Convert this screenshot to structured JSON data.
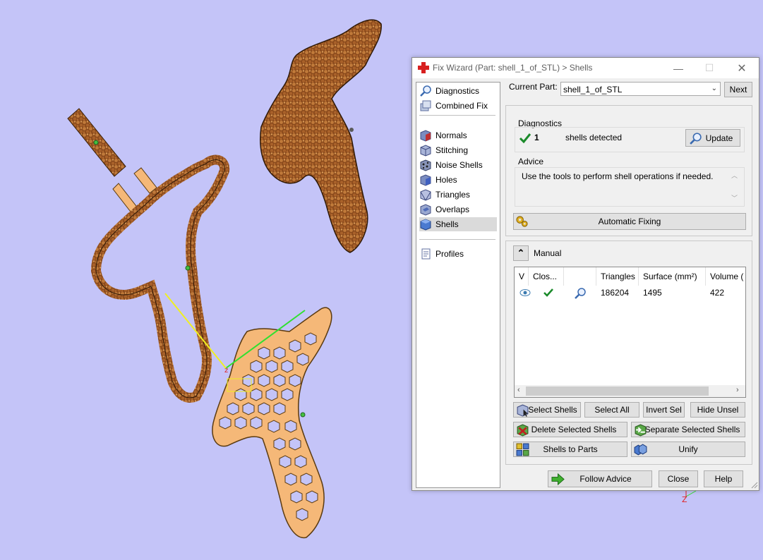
{
  "window": {
    "title": "Fix Wizard (Part: shell_1_of_STL) > Shells",
    "min_glyph": "—",
    "max_glyph": "☐",
    "close_glyph": "✕"
  },
  "nav": {
    "items": [
      {
        "label": "Diagnostics",
        "icon": "magnifier-icon"
      },
      {
        "label": "Combined Fix",
        "icon": "box-stack-icon"
      },
      {
        "label": "Normals",
        "icon": "normals-cube-icon"
      },
      {
        "label": "Stitching",
        "icon": "stitching-cube-icon"
      },
      {
        "label": "Noise Shells",
        "icon": "noise-shells-icon"
      },
      {
        "label": "Holes",
        "icon": "holes-cube-icon"
      },
      {
        "label": "Triangles",
        "icon": "triangles-cube-icon"
      },
      {
        "label": "Overlaps",
        "icon": "overlaps-cube-icon"
      },
      {
        "label": "Shells",
        "icon": "shells-cube-icon"
      },
      {
        "label": "Profiles",
        "icon": "document-icon"
      }
    ],
    "selected": "Shells"
  },
  "part": {
    "label": "Current Part:",
    "value": "shell_1_of_STL",
    "next_label": "Next"
  },
  "diagnostics": {
    "heading": "Diagnostics",
    "count": "1",
    "text": "shells detected",
    "update_label": "Update"
  },
  "advice": {
    "heading": "Advice",
    "text": "Use the tools to perform shell operations if needed."
  },
  "automatic_fixing_label": "Automatic Fixing",
  "manual": {
    "label": "Manual",
    "columns": [
      "V",
      "Clos...",
      "",
      "Triangles",
      "Surface (mm²)",
      "Volume ("
    ],
    "rows": [
      {
        "triangles": "186204",
        "surface": "1495",
        "volume": "422"
      }
    ]
  },
  "actions": {
    "select_shells": "Select Shells",
    "select_all": "Select All",
    "invert_sel": "Invert Sel",
    "hide_unsel": "Hide Unsel",
    "delete_selected": "Delete Selected Shells",
    "separate_selected": "Separate Selected Shells",
    "shells_to_parts": "Shells to Parts",
    "unify": "Unify"
  },
  "footer": {
    "follow_advice": "Follow Advice",
    "close": "Close",
    "help": "Help"
  },
  "viewport": {
    "axis_label": "Z",
    "background": "#c4c4f8",
    "part_fill": "#f5b878",
    "part_texture": "#8a4a1c"
  }
}
